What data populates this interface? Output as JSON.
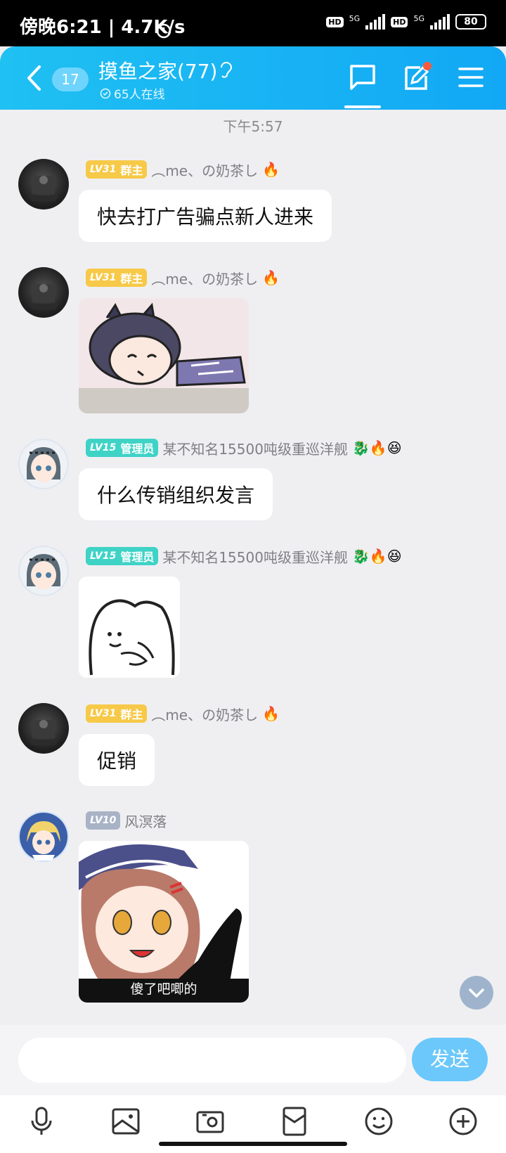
{
  "status_bar": {
    "left_text": "傍晚6:21 | 4.7K/s",
    "hd1": "HD",
    "net1": "5G",
    "hd2": "HD",
    "net2": "5G",
    "battery": "80"
  },
  "header": {
    "unread_count": "17",
    "group_title": "摸鱼之家(77)",
    "online_text": "65人在线",
    "colors": {
      "gradient_start": "#1fc0f2",
      "gradient_end": "#12a8f5"
    }
  },
  "chat": {
    "timestamp": "下午5:57",
    "messages": [
      {
        "level": "LV31",
        "role": "群主",
        "level_color": "#f7c948",
        "name": "︵me、の奶茶し",
        "badges": "🔥",
        "type": "text",
        "text": "快去打广告骗点新人进来"
      },
      {
        "level": "LV31",
        "role": "群主",
        "level_color": "#f7c948",
        "name": "︵me、の奶茶し",
        "badges": "🔥",
        "type": "sticker",
        "sticker": "sleeping-cat-girl"
      },
      {
        "level": "LV15",
        "role": "管理员",
        "level_color": "#3fd3c6",
        "name": "某不知名15500吨级重巡洋舰",
        "badges": "🐉🔥😆",
        "type": "text",
        "text": "什么传销组织发言"
      },
      {
        "level": "LV15",
        "role": "管理员",
        "level_color": "#3fd3c6",
        "name": "某不知名15500吨级重巡洋舰",
        "badges": "🐉🔥😆",
        "type": "sticker",
        "sticker": "doodle-blob"
      },
      {
        "level": "LV31",
        "role": "群主",
        "level_color": "#f7c948",
        "name": "︵me、の奶茶し",
        "badges": "🔥",
        "type": "text",
        "text": "促销"
      },
      {
        "level": "LV10",
        "role": "",
        "level_color": "#a9b3c6",
        "name": "风溟落",
        "badges": "",
        "type": "sticker",
        "sticker": "anime-girl-caption",
        "caption": "傻了吧唧的"
      }
    ]
  },
  "input": {
    "placeholder": "",
    "send_label": "发送"
  }
}
